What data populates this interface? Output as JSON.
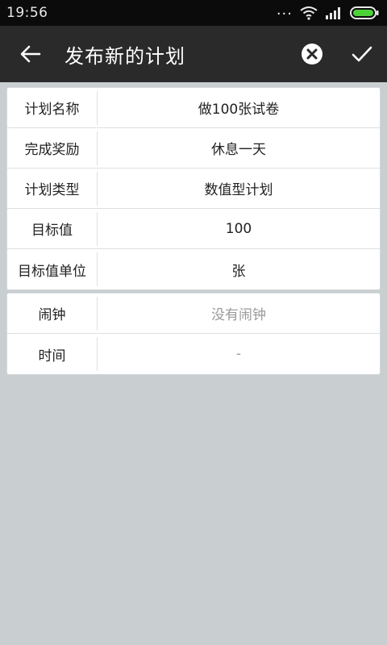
{
  "status_bar": {
    "time": "19:56",
    "dots": "...",
    "icons": [
      "wifi-icon",
      "signal-icon",
      "battery-icon"
    ]
  },
  "header": {
    "title": "发布新的计划",
    "back_icon": "arrow-left-icon",
    "cancel_icon": "close-circle-icon",
    "confirm_icon": "check-icon"
  },
  "plan_fields": [
    {
      "label": "计划名称",
      "value": "做100张试卷"
    },
    {
      "label": "完成奖励",
      "value": "休息一天"
    },
    {
      "label": "计划类型",
      "value": "数值型计划"
    },
    {
      "label": "目标值",
      "value": "100"
    },
    {
      "label": "目标值单位",
      "value": "张"
    }
  ],
  "alarm_fields": [
    {
      "label": "闹钟",
      "value": "没有闹钟"
    },
    {
      "label": "时间",
      "value": "-"
    }
  ],
  "colors": {
    "status_bar": "#0b0b0b",
    "app_bar": "#2a2a2a",
    "background": "#c9ced1",
    "battery_green": "#4cd137",
    "placeholder": "#9a9a9a"
  }
}
